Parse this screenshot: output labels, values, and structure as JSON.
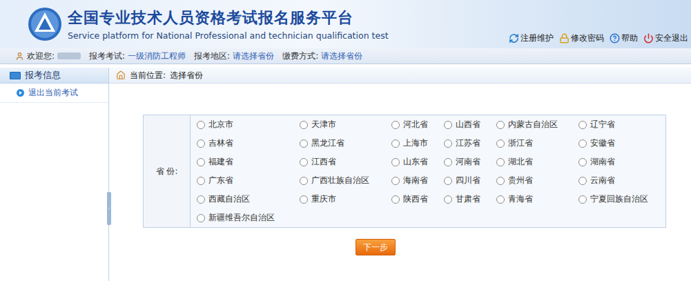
{
  "header": {
    "title": "全国专业技术人员资格考试报名服务平台",
    "subtitle": "Service platform for National Professional and technician qualification test",
    "links": [
      "注册维护",
      "修改密码",
      "帮助",
      "安全退出"
    ]
  },
  "info_bar": {
    "welcome": "欢迎您:",
    "fields": [
      {
        "label": "报考考试:",
        "value": "一级消防工程师"
      },
      {
        "label": "报考地区:",
        "value": "请选择省份"
      },
      {
        "label": "缴费方式:",
        "value": "请选择省份"
      }
    ]
  },
  "sidebar": {
    "title": "报考信息",
    "items": [
      "退出当前考试"
    ]
  },
  "breadcrumb": {
    "label": "当前位置:",
    "value": "选择省份"
  },
  "form": {
    "label": "省 份:",
    "provinces": [
      {
        "name": "北京市",
        "selected": false
      },
      {
        "name": "天津市",
        "selected": false
      },
      {
        "name": "河北省",
        "selected": false
      },
      {
        "name": "山西省",
        "selected": false
      },
      {
        "name": "内蒙古自治区",
        "selected": false
      },
      {
        "name": "辽宁省",
        "selected": false
      },
      {
        "name": "吉林省",
        "selected": false
      },
      {
        "name": "黑龙江省",
        "selected": false
      },
      {
        "name": "上海市",
        "selected": false
      },
      {
        "name": "江苏省",
        "selected": false
      },
      {
        "name": "浙江省",
        "selected": false
      },
      {
        "name": "安徽省",
        "selected": false
      },
      {
        "name": "福建省",
        "selected": false
      },
      {
        "name": "江西省",
        "selected": false
      },
      {
        "name": "山东省",
        "selected": false
      },
      {
        "name": "河南省",
        "selected": false
      },
      {
        "name": "湖北省",
        "selected": false
      },
      {
        "name": "湖南省",
        "selected": false
      },
      {
        "name": "广东省",
        "selected": false
      },
      {
        "name": "广西壮族自治区",
        "selected": false
      },
      {
        "name": "海南省",
        "selected": false
      },
      {
        "name": "四川省",
        "selected": false
      },
      {
        "name": "贵州省",
        "selected": false
      },
      {
        "name": "云南省",
        "selected": false
      },
      {
        "name": "西藏自治区",
        "selected": false
      },
      {
        "name": "重庆市",
        "selected": false
      },
      {
        "name": "陕西省",
        "selected": false
      },
      {
        "name": "甘肃省",
        "selected": false
      },
      {
        "name": "青海省",
        "selected": false
      },
      {
        "name": "宁夏回族自治区",
        "selected": false
      },
      {
        "name": "新疆维吾尔自治区",
        "selected": false
      }
    ]
  },
  "buttons": [
    "下一步"
  ]
}
